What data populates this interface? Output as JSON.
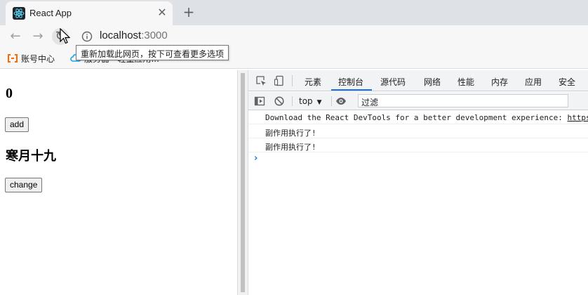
{
  "browser": {
    "tab_title": "React App",
    "tab_close": "✕",
    "new_tab": "+",
    "url_host": "localhost",
    "url_port": ":3000",
    "reload_tooltip": "重新加载此网页，按下可查看更多选项",
    "bookmarks": [
      {
        "label": "账号中心"
      },
      {
        "label": "服务器 · 轻量应用..."
      }
    ]
  },
  "page": {
    "count": "0",
    "add_button": "add",
    "name": "寒月十九",
    "change_button": "change"
  },
  "devtools": {
    "tabs": [
      {
        "label": "元素"
      },
      {
        "label": "控制台"
      },
      {
        "label": "源代码"
      },
      {
        "label": "网络"
      },
      {
        "label": "性能"
      },
      {
        "label": "内存"
      },
      {
        "label": "应用"
      },
      {
        "label": "安全"
      }
    ],
    "active_tab": "控制台",
    "context": "top",
    "filter_placeholder": "过滤",
    "console": {
      "devtools_msg": "Download the React DevTools for a better development experience: ",
      "devtools_link": "https",
      "logs": [
        "副作用执行了!",
        "副作用执行了!"
      ],
      "prompt": "›"
    }
  },
  "colors": {
    "accent": "#1a73e8",
    "tab_strip": "#dee1e6",
    "toolbar": "#f7f7f7"
  }
}
